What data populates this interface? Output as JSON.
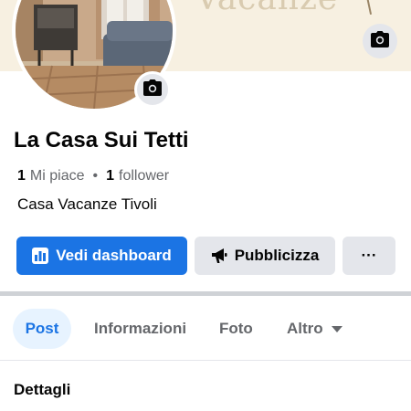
{
  "cover": {
    "text": "Vacanze"
  },
  "page": {
    "name": "La Casa Sui Tetti",
    "likes_count": "1",
    "likes_label": "Mi piace",
    "followers_count": "1",
    "followers_label": "follower",
    "category": "Casa Vacanze Tivoli"
  },
  "actions": {
    "dashboard": "Vedi dashboard",
    "promote": "Pubblicizza",
    "more": "···"
  },
  "tabs": [
    {
      "label": "Post",
      "active": true
    },
    {
      "label": "Informazioni"
    },
    {
      "label": "Foto"
    },
    {
      "label": "Altro"
    }
  ],
  "section": {
    "title": "Dettagli"
  },
  "colors": {
    "accent": "#1b74e4",
    "accent_light": "#e7f3ff",
    "button_gray": "#e4e6eb",
    "text_secondary": "#65676b"
  },
  "icons": {
    "cover_camera": "camera-icon",
    "avatar_camera": "camera-icon",
    "dashboard": "bar-chart-icon",
    "promote": "megaphone-icon",
    "altro_caret": "caret-down-icon"
  }
}
